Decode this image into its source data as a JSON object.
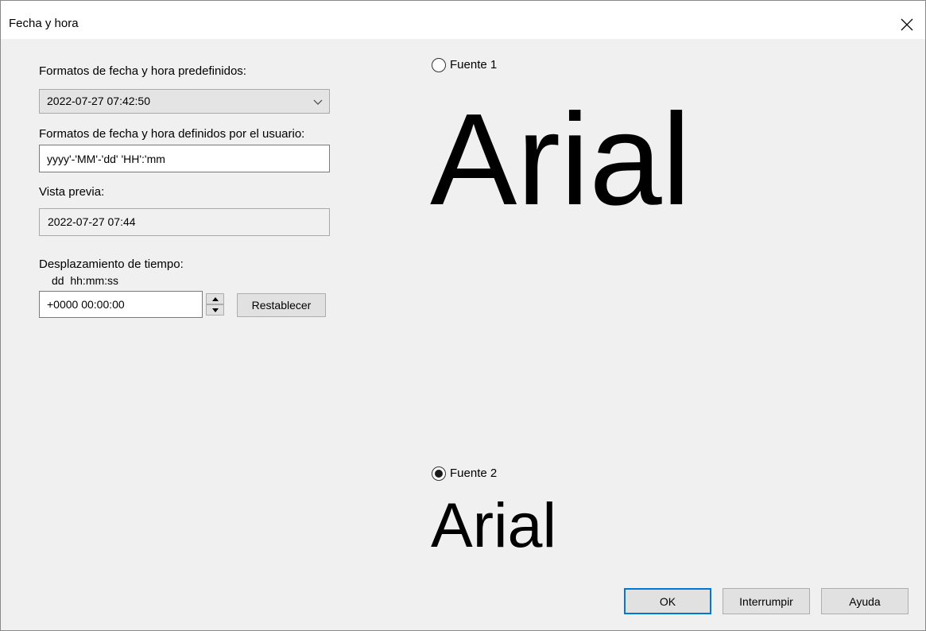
{
  "window": {
    "title": "Fecha y hora"
  },
  "left_panel": {
    "predefined_label": "Formatos de fecha y hora predefinidos:",
    "predefined_selected": "2022-07-27 07:42:50",
    "user_defined_label": "Formatos de fecha y hora definidos por el usuario:",
    "user_defined_value": "yyyy'-'MM'-'dd' 'HH':'mm",
    "preview_label": "Vista previa:",
    "preview_value": "2022-07-27 07:44",
    "offset_label": "Desplazamiento de tiempo:",
    "offset_format_hint": "dd  hh:mm:ss",
    "offset_value": "+0000 00:00:00",
    "reset_label": "Restablecer"
  },
  "right_panel": {
    "font1": {
      "label": "Fuente 1",
      "sample": "Arial",
      "selected": false
    },
    "font2": {
      "label": "Fuente 2",
      "sample": "Arial",
      "selected": true
    }
  },
  "footer": {
    "ok_label": "OK",
    "abort_label": "Interrumpir",
    "help_label": "Ayuda"
  },
  "colors": {
    "dialog_bg": "#f0f0f0",
    "titlebar_bg": "#ffffff",
    "accent": "#0078d7"
  },
  "icons": {
    "close": "close-icon",
    "combo": "chevron-down-icon",
    "spin_up": "triangle-up-icon",
    "spin_down": "triangle-down-icon"
  }
}
